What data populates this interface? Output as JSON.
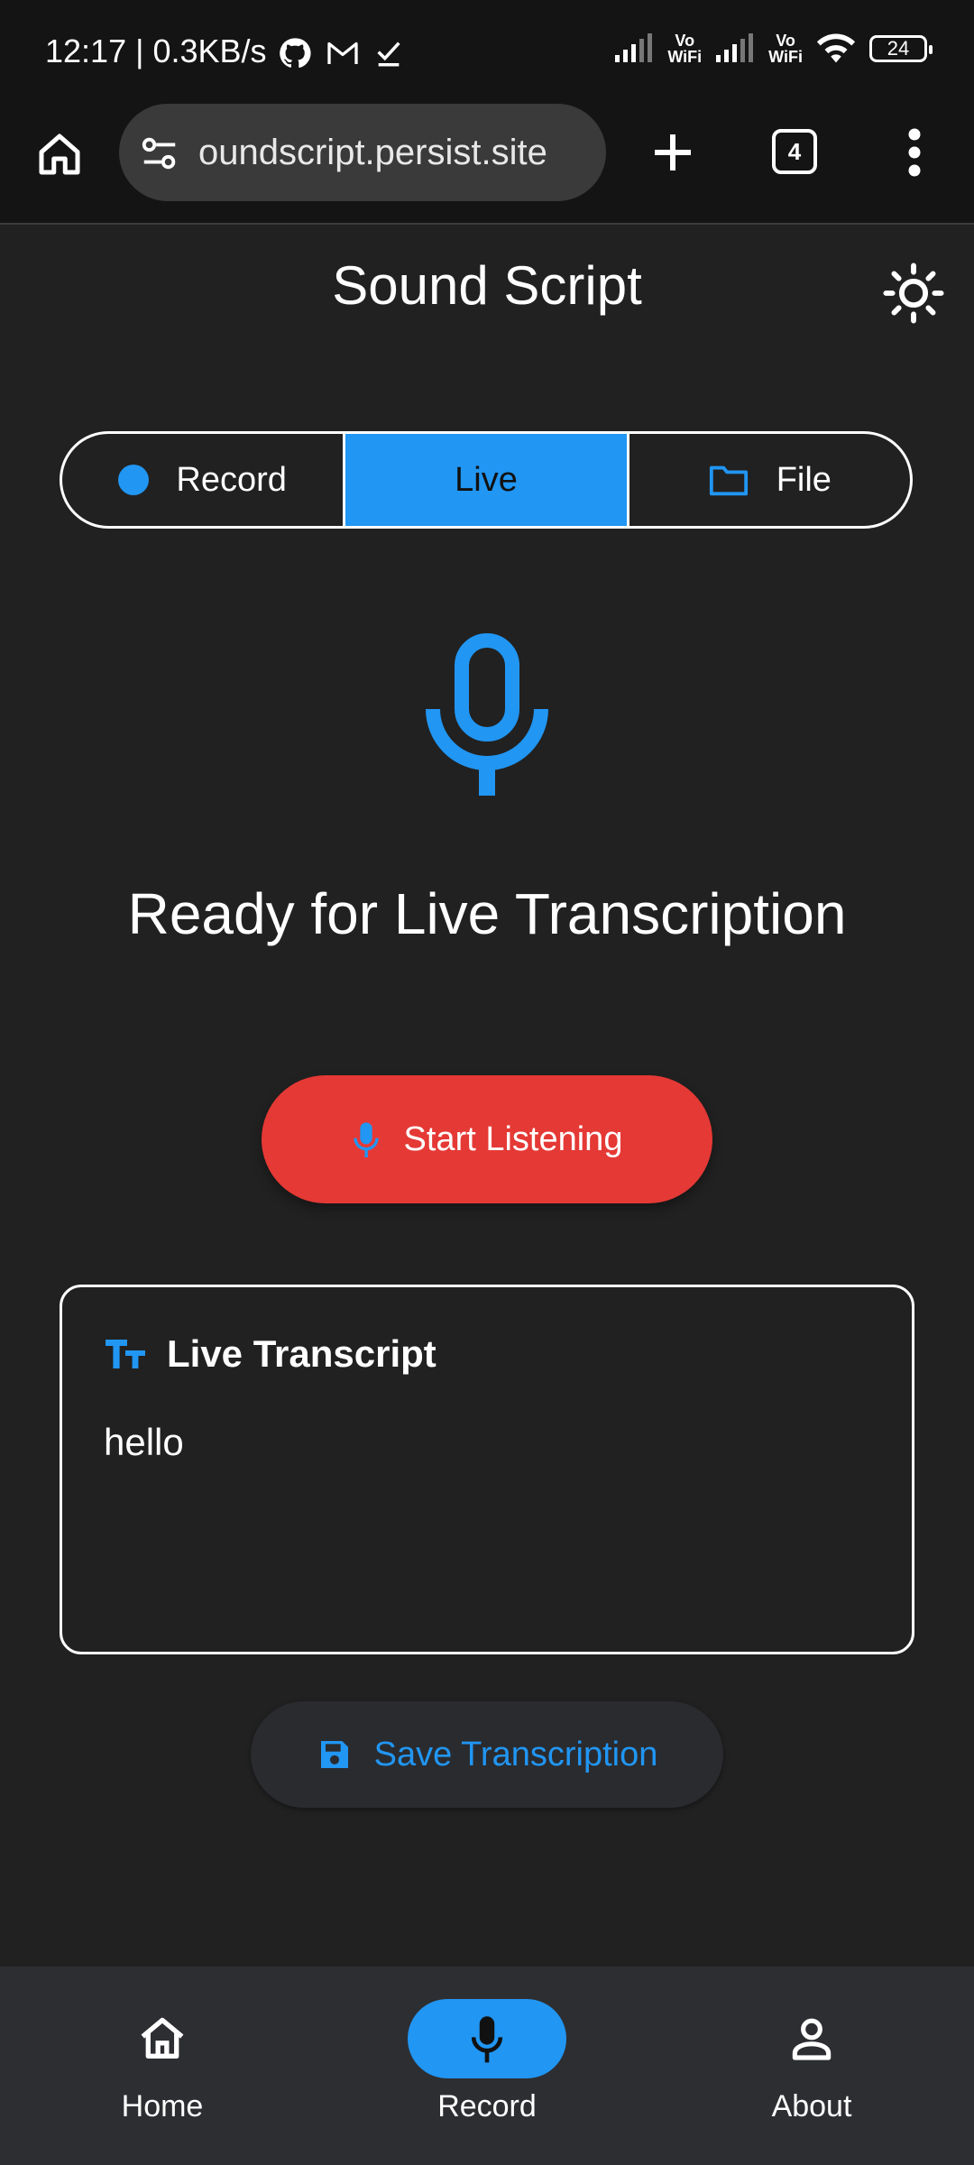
{
  "status_bar": {
    "time_speed": "12:17 | 0.3KB/s",
    "vowifi_1": "Vo\nWiFi",
    "vowifi_2": "Vo\nWiFi",
    "battery": "24"
  },
  "browser": {
    "url": "oundscript.persist.site",
    "tab_count": "4"
  },
  "app": {
    "title": "Sound Script"
  },
  "modes": {
    "tabs": [
      {
        "label": "Record"
      },
      {
        "label": "Live"
      },
      {
        "label": "File"
      }
    ],
    "active": "Live"
  },
  "main": {
    "status_text": "Ready for Live Transcription",
    "start_button_label": "Start Listening"
  },
  "transcript": {
    "heading": "Live Transcript",
    "text": "hello"
  },
  "save_button_label": "Save Transcription",
  "bottom_nav": {
    "items": [
      {
        "label": "Home",
        "icon": "home-icon"
      },
      {
        "label": "Record",
        "icon": "mic-icon"
      },
      {
        "label": "About",
        "icon": "person-icon"
      }
    ],
    "active": "Record"
  },
  "colors": {
    "accent": "#2196F3",
    "danger": "#E53935",
    "background": "#212121"
  }
}
